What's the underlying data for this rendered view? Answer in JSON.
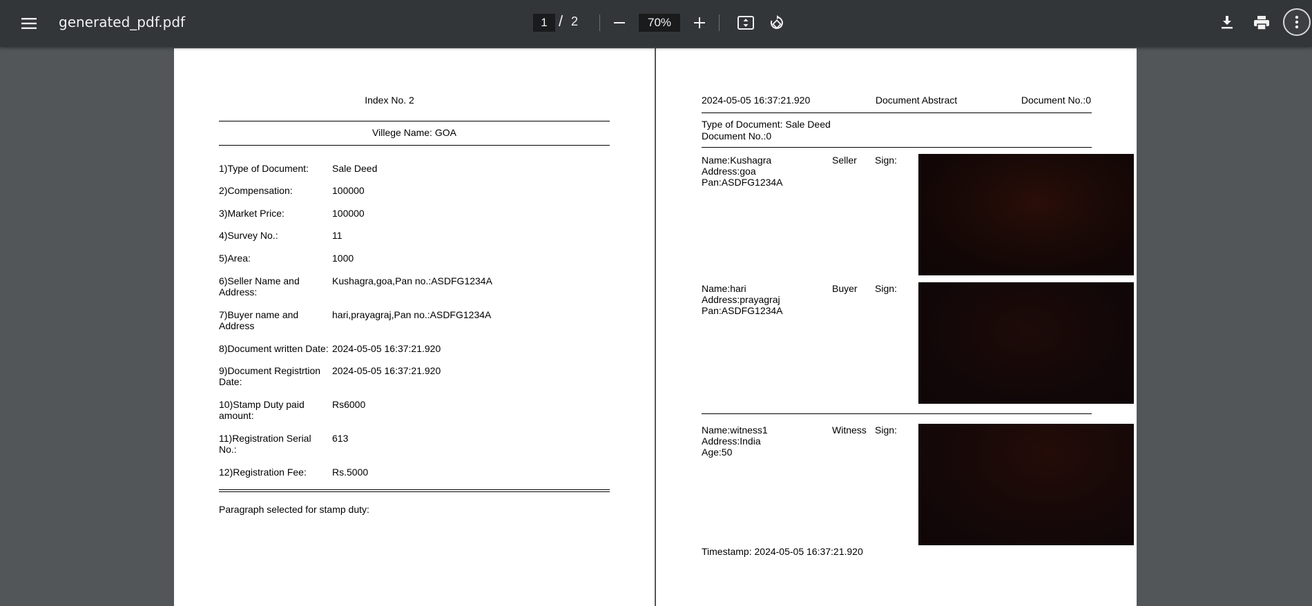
{
  "toolbar": {
    "filename": "generated_pdf.pdf",
    "current_page": "1",
    "page_separator": "/",
    "total_pages": "2",
    "zoom": "70%",
    "icons": [
      "menu-icon",
      "zoom-out-icon",
      "zoom-in-icon",
      "fit-page-icon",
      "rotate-icon",
      "download-icon",
      "print-icon",
      "more-vert-icon"
    ]
  },
  "page1": {
    "index_title": "Index No. 2",
    "village": "Villege Name: GOA",
    "rows": [
      {
        "label": "1)Type of Document:",
        "value": "Sale Deed"
      },
      {
        "label": "2)Compensation:",
        "value": "100000"
      },
      {
        "label": "3)Market Price:",
        "value": "100000"
      },
      {
        "label": "4)Survey No.:",
        "value": "11"
      },
      {
        "label": "5)Area:",
        "value": "1000"
      },
      {
        "label": "6)Seller Name and Address:",
        "value": "Kushagra,goa,Pan no.:ASDFG1234A"
      },
      {
        "label": "7)Buyer name and Address",
        "value": "hari,prayagraj,Pan no.:ASDFG1234A"
      },
      {
        "label": "8)Document written Date:",
        "value": "2024-05-05 16:37:21.920"
      },
      {
        "label": "9)Document Registrtion Date:",
        "value": "2024-05-05 16:37:21.920"
      },
      {
        "label": "10)Stamp Duty paid amount:",
        "value": "Rs6000"
      },
      {
        "label": "11)Registration Serial No.:",
        "value": "613"
      },
      {
        "label": "12)Registration Fee:",
        "value": "Rs.5000"
      }
    ],
    "paragraph_note": "Paragraph selected for stamp duty:"
  },
  "page2": {
    "header_date": "2024-05-05 16:37:21.920",
    "header_title": "Document Abstract",
    "header_docno": "Document No.:0",
    "type_line": "Type of Document: Sale Deed",
    "docno_line": "Document No.:0",
    "parties": [
      {
        "name": "Name:Kushagra",
        "address": "Address:goa",
        "extra": "Pan:ASDFG1234A",
        "role": "Seller",
        "sign": "Sign:"
      },
      {
        "name": "Name:hari",
        "address": "Address:prayagraj",
        "extra": "Pan:ASDFG1234A",
        "role": "Buyer",
        "sign": "Sign:"
      },
      {
        "name": "Name:witness1",
        "address": "Address:India",
        "extra": "Age:50",
        "role": "Witness",
        "sign": "Sign:"
      }
    ],
    "timestamp": "Timestamp: 2024-05-05 16:37:21.920"
  }
}
